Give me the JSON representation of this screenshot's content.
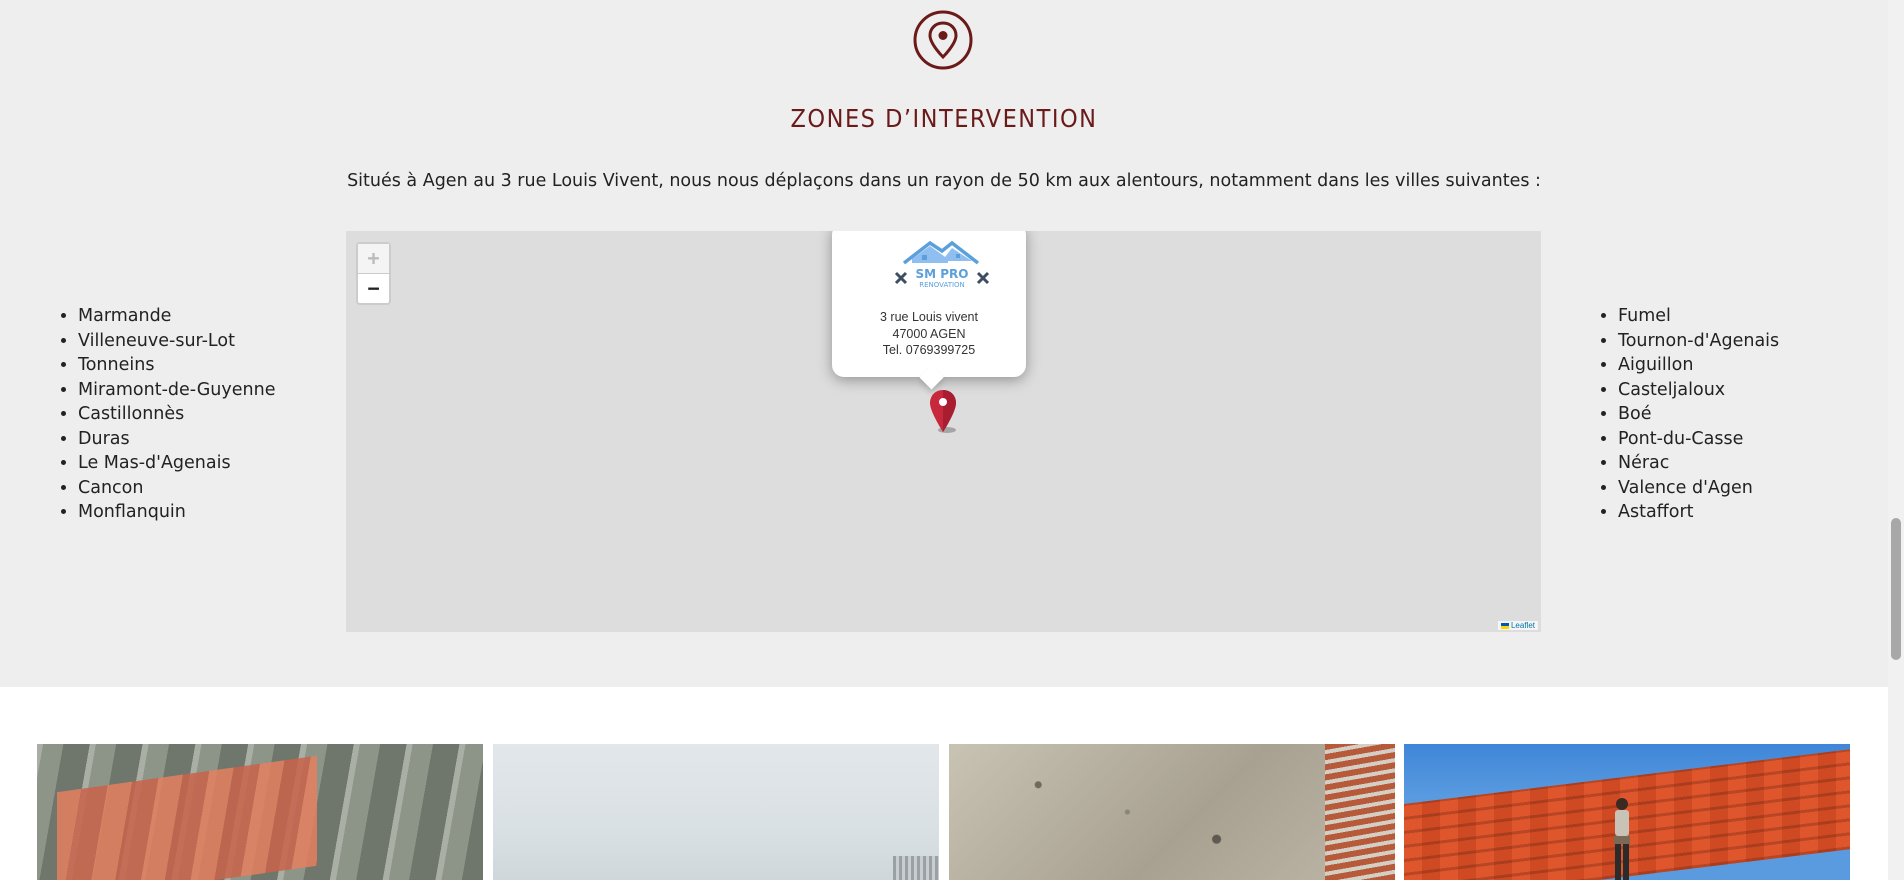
{
  "zones": {
    "icon": "location-pin-icon",
    "title": "ZONES D’INTERVENTION",
    "intro": "Situés à Agen au 3 rue Louis Vivent, nous nous déplaçons dans un rayon de 50 km aux alentours, notamment dans les villes suivantes :",
    "cities_left": [
      "Marmande",
      "Villeneuve-sur-Lot",
      "Tonneins",
      "Miramont-de-Guyenne",
      "Castillonnès",
      "Duras",
      "Le Mas-d'Agenais",
      "Cancon",
      "Monflanquin"
    ],
    "cities_right": [
      "Fumel",
      "Tournon-d'Agenais",
      "Aiguillon",
      "Casteljaloux",
      "Boé",
      "Pont-du-Casse",
      "Nérac",
      "Valence d'Agen",
      "Astaffort"
    ]
  },
  "map": {
    "zoom_in": "+",
    "zoom_out": "−",
    "popup": {
      "logo_text_line1": "SM PRO",
      "logo_text_line2": "RENOVATION",
      "address_line1": "3 rue Louis vivent",
      "address_line2": "47000 AGEN",
      "phone": "Tel. 0769399725"
    },
    "attribution": "Leaflet"
  },
  "gallery": [
    {
      "name": "roof-tiles-moss-photo"
    },
    {
      "name": "sky-roof-photo"
    },
    {
      "name": "stone-wall-photo"
    },
    {
      "name": "roofer-on-roof-photo"
    }
  ],
  "colors": {
    "accent": "#6b1a1a",
    "section_bg": "#eeeeee",
    "map_bg": "#dddddd",
    "marker": "#c7283b",
    "logo_blue": "#5b9fdb"
  }
}
